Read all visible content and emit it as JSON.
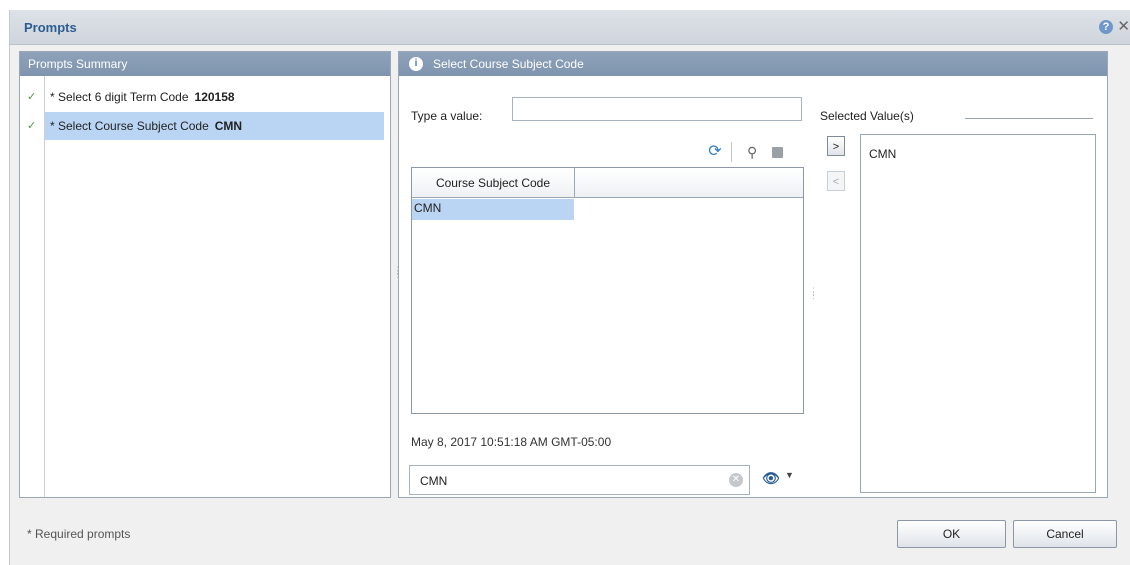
{
  "dialog": {
    "title": "Prompts",
    "help_glyph": "?",
    "close_glyph": "✕"
  },
  "summary": {
    "header": "Prompts Summary",
    "items": [
      {
        "label": "* Select 6 digit Term Code",
        "value": "120158",
        "check": "✓"
      },
      {
        "label": "* Select Course Subject Code",
        "value": "CMN",
        "check": "✓"
      }
    ]
  },
  "panel": {
    "header": "Select Course Subject Code",
    "info_glyph": "i",
    "type_label": "Type a value:",
    "type_value": "",
    "list": {
      "column_header": "Course Subject Code",
      "rows": [
        "CMN"
      ]
    },
    "timestamp": "May 8, 2017 10:51:18 AM GMT-05:00",
    "search_value": "CMN",
    "move_right": ">",
    "move_left": "<",
    "selected_label": "Selected Value(s)",
    "selected_values": [
      "CMN"
    ]
  },
  "footer": {
    "note": "* Required prompts",
    "ok": "OK",
    "cancel": "Cancel"
  },
  "icons": {
    "refresh": "⟳",
    "key": "🔑",
    "binoculars": "🔭",
    "dropdown": "▼",
    "clear": "✕"
  }
}
